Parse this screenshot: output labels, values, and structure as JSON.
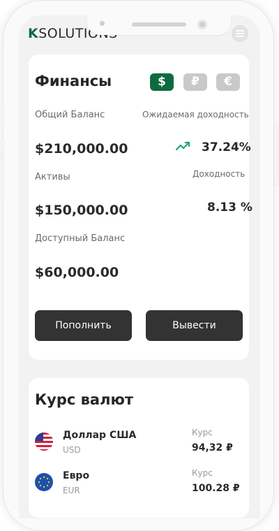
{
  "app": {
    "logo_k": "K",
    "logo_rest": "SOLUTIONS"
  },
  "colors": {
    "accent": "#0d6b3f",
    "inactive": "#c9c9c9",
    "dark_button": "#333333",
    "trend": "#1aa67a"
  },
  "finance": {
    "title": "Финансы",
    "currencies": [
      {
        "symbol": "$",
        "active": true
      },
      {
        "symbol": "₽",
        "active": false
      },
      {
        "symbol": "€",
        "active": false
      }
    ],
    "total_balance_label": "Общий Баланс",
    "expected_yield_label": "Ожидаемая доходность",
    "total_balance": "$210,000.00",
    "expected_yield": "37.24%",
    "trend_icon": "trending-up-icon",
    "assets_label": "Активы",
    "yield_label": "Доходность",
    "assets": "$150,000.00",
    "yield": "8.13 %",
    "available_label": "Доступный Баланс",
    "available": "$60,000.00",
    "deposit_button": "Пополнить",
    "withdraw_button": "Вывести"
  },
  "rates": {
    "title": "Курс валют",
    "items": [
      {
        "name": "Доллар США",
        "code": "USD",
        "rate_label": "Курс",
        "rate": "94,32 ₽",
        "flag": "us-flag-icon"
      },
      {
        "name": "Евро",
        "code": "EUR",
        "rate_label": "Курс",
        "rate": "100.28 ₽",
        "flag": "eu-flag-icon"
      }
    ]
  }
}
